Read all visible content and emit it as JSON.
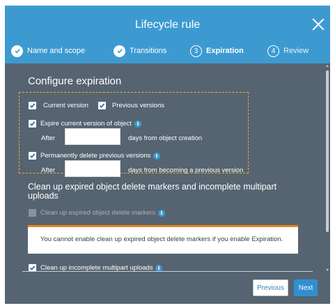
{
  "dialog": {
    "title": "Lifecycle rule",
    "close_icon": "close-icon"
  },
  "steps": [
    {
      "label": "Name and scope",
      "marker": "check",
      "state": "done"
    },
    {
      "label": "Transitions",
      "marker": "check",
      "state": "done"
    },
    {
      "label": "Expiration",
      "marker": "3",
      "state": "active"
    },
    {
      "label": "Review",
      "marker": "4",
      "state": "idle"
    }
  ],
  "configure": {
    "title": "Configure expiration",
    "current_version": {
      "label": "Current version",
      "checked": true
    },
    "previous_versions": {
      "label": "Previous versions",
      "checked": true
    },
    "expire_current": {
      "label": "Expire current version of object",
      "checked": true,
      "after_label": "After",
      "value": "",
      "suffix": "days from object creation"
    },
    "delete_previous": {
      "label": "Permanently delete previous versions",
      "checked": true,
      "after_label": "After",
      "value": "",
      "suffix": "days from becoming a previous version"
    }
  },
  "cleanup": {
    "title": "Clean up expired object delete markers and incomplete multipart uploads",
    "delete_markers": {
      "label": "Clean up expired object delete markers",
      "checked": false,
      "disabled": true
    },
    "notice": "You cannot enable clean up expired object delete markers if you enable Expiration.",
    "incomplete_uploads": {
      "label": "Clean up incomplete multipart uploads",
      "checked": true
    }
  },
  "footer": {
    "previous_label": "Previous",
    "next_label": "Next"
  },
  "colors": {
    "header": "#3d9ad1",
    "body": "#566471",
    "highlight": "#f0ad28",
    "notice_accent": "#f1841d",
    "primary_button": "#2f8fd0"
  }
}
